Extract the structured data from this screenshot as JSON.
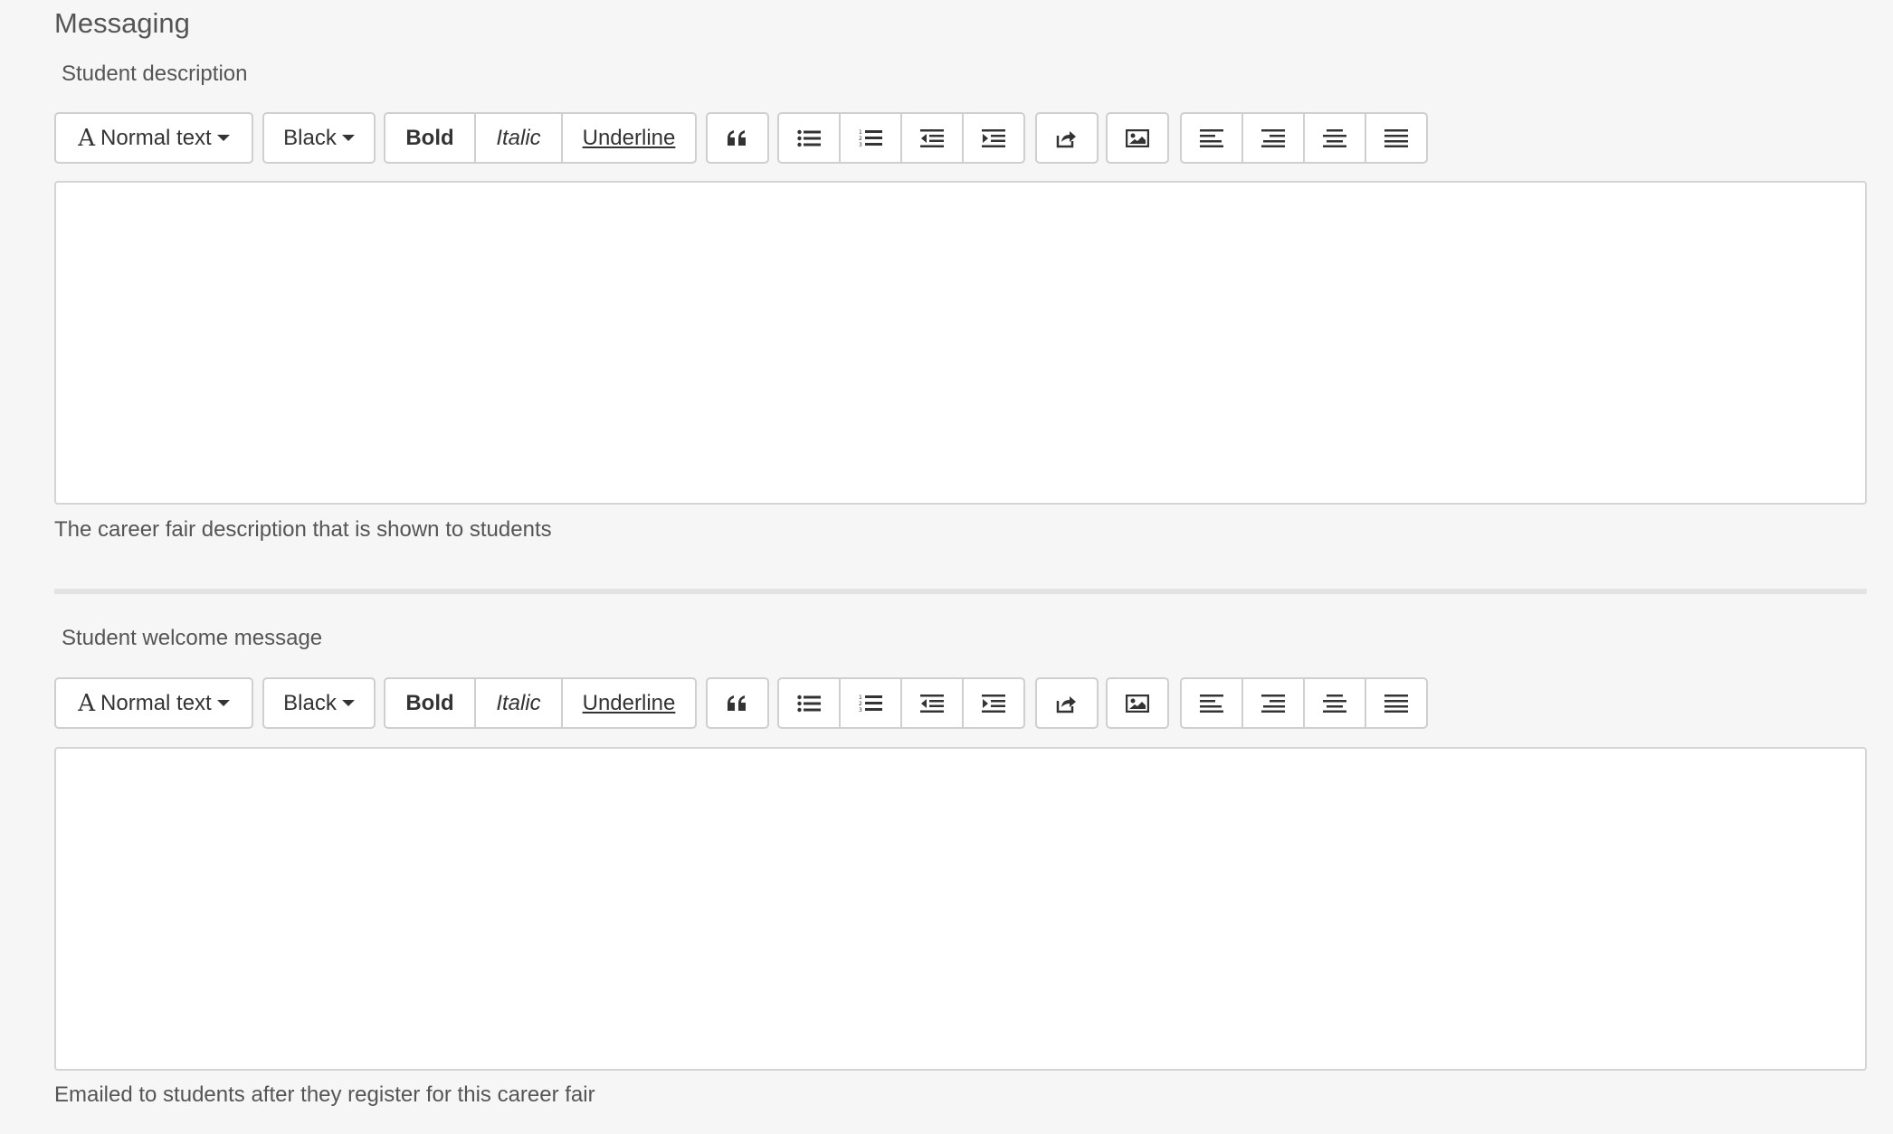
{
  "section": {
    "title": "Messaging"
  },
  "editors": [
    {
      "label": "Student description",
      "help": "The career fair description that is shown to students",
      "toolbar": {
        "format_label": "Normal text",
        "color_label": "Black",
        "bold_label": "Bold",
        "italic_label": "Italic",
        "underline_label": "Underline"
      },
      "content": ""
    },
    {
      "label": "Student welcome message",
      "help": "Emailed to students after they register for this career fair",
      "toolbar": {
        "format_label": "Normal text",
        "color_label": "Black",
        "bold_label": "Bold",
        "italic_label": "Italic",
        "underline_label": "Underline"
      },
      "content": ""
    }
  ],
  "icons": [
    "font-icon",
    "quote-icon",
    "bullet-list-icon",
    "numbered-list-icon",
    "outdent-icon",
    "indent-icon",
    "share-icon",
    "image-icon",
    "align-left-icon",
    "align-right-icon",
    "align-center-icon",
    "align-justify-icon"
  ],
  "colors": {
    "background": "#f6f6f6",
    "border": "#cfcfcf",
    "text": "#444444"
  }
}
